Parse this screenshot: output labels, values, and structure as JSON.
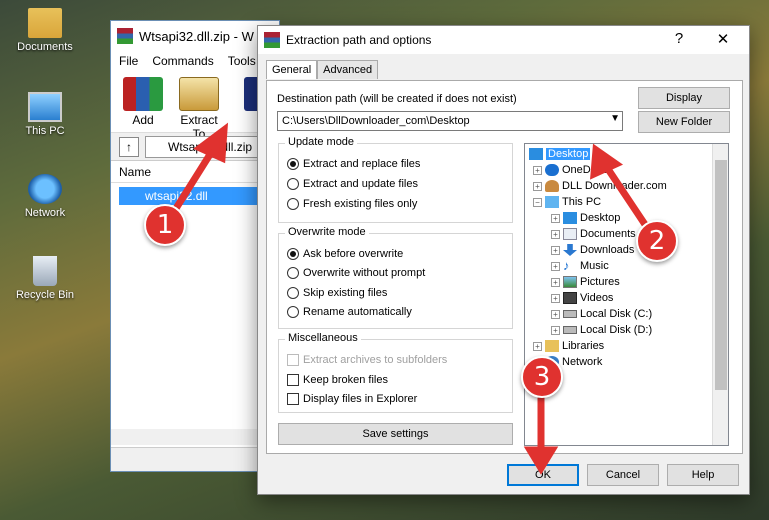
{
  "desktop": {
    "icons": [
      {
        "label": "Documents",
        "icon": "folder-icon"
      },
      {
        "label": "This PC",
        "icon": "computer-icon"
      },
      {
        "label": "Network",
        "icon": "network-icon"
      },
      {
        "label": "Recycle Bin",
        "icon": "recycle-bin-icon"
      }
    ]
  },
  "winrar": {
    "title": "Wtsapi32.dll.zip - W",
    "menu": [
      "File",
      "Commands",
      "Tools"
    ],
    "toolbar": [
      {
        "label": "Add",
        "icon": "add-archive-icon"
      },
      {
        "label": "Extract To",
        "icon": "extract-to-icon"
      }
    ],
    "address": "Wtsapi32.dll.zip",
    "column_name": "Name",
    "file": "wtsapi32.dll"
  },
  "dialog": {
    "title": "Extraction path and options",
    "help_glyph": "?",
    "close_glyph": "✕",
    "tabs": [
      "General",
      "Advanced"
    ],
    "destination_label": "Destination path (will be created if does not exist)",
    "destination_value": "C:\\Users\\DllDownloader_com\\Desktop",
    "display_button": "Display",
    "new_folder_button": "New Folder",
    "update_mode": {
      "title": "Update mode",
      "options": [
        "Extract and replace files",
        "Extract and update files",
        "Fresh existing files only"
      ],
      "selected": 0
    },
    "overwrite_mode": {
      "title": "Overwrite mode",
      "options": [
        "Ask before overwrite",
        "Overwrite without prompt",
        "Skip existing files",
        "Rename automatically"
      ],
      "selected": 0
    },
    "misc": {
      "title": "Miscellaneous",
      "options": [
        "Extract archives to subfolders",
        "Keep broken files",
        "Display files in Explorer"
      ]
    },
    "save_settings": "Save settings",
    "tree": [
      {
        "label": "Desktop",
        "icon": "desktop-icon",
        "selected": true
      },
      {
        "label": "OneDrive",
        "icon": "cloud-icon"
      },
      {
        "label": "DLL Downloader.com",
        "icon": "user-icon"
      },
      {
        "label": "This PC",
        "icon": "computer-icon"
      },
      {
        "label": "Desktop",
        "icon": "desktop-icon"
      },
      {
        "label": "Documents",
        "icon": "document-icon"
      },
      {
        "label": "Downloads",
        "icon": "download-icon"
      },
      {
        "label": "Music",
        "icon": "music-icon"
      },
      {
        "label": "Pictures",
        "icon": "pictures-icon"
      },
      {
        "label": "Videos",
        "icon": "video-icon"
      },
      {
        "label": "Local Disk (C:)",
        "icon": "drive-icon"
      },
      {
        "label": "Local Disk (D:)",
        "icon": "drive-icon"
      },
      {
        "label": "Libraries",
        "icon": "folder-icon"
      },
      {
        "label": "Network",
        "icon": "network-icon"
      }
    ],
    "ok": "OK",
    "cancel": "Cancel",
    "help": "Help"
  },
  "annotations": [
    "1",
    "2",
    "3"
  ],
  "colors": {
    "accent": "#0078d7",
    "selection": "#3399ff",
    "arrow": "#e0322f"
  }
}
